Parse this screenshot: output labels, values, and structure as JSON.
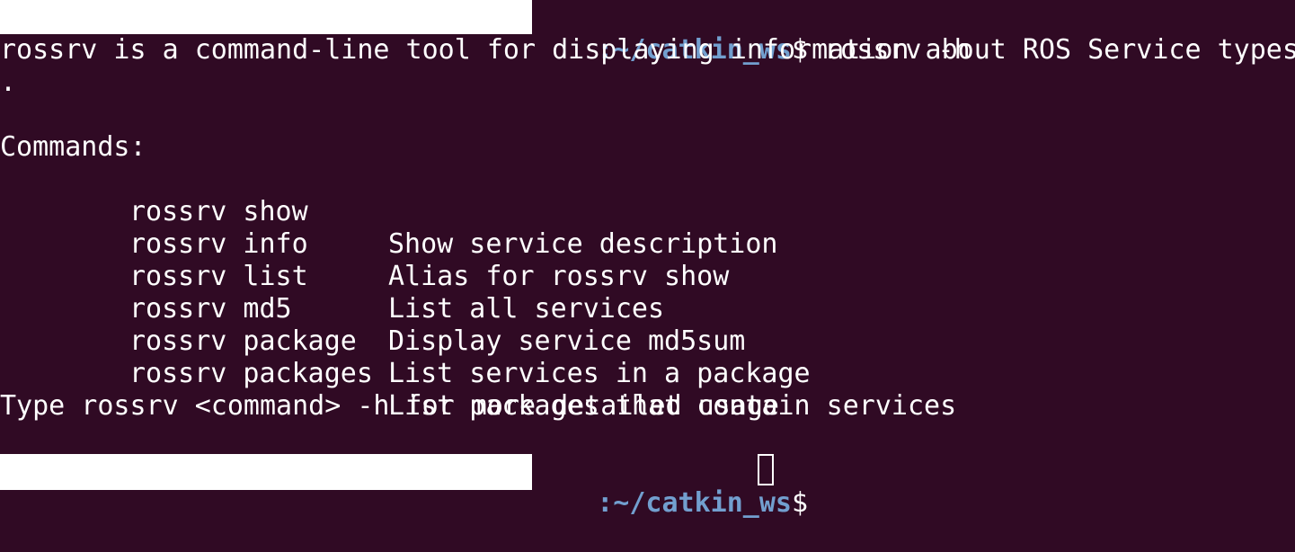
{
  "prompt1": {
    "path": ":~/catkin_ws",
    "symbol": "$",
    "command": " rossrv -h"
  },
  "output": {
    "description_line": "rossrv is a command-line tool for displaying information about ROS Service types",
    "description_wrap": ".",
    "commands_header": "Commands:",
    "commands": [
      {
        "name": "rossrv show",
        "desc": "Show service description"
      },
      {
        "name": "rossrv info",
        "desc": "Alias for rossrv show"
      },
      {
        "name": "rossrv list",
        "desc": "List all services"
      },
      {
        "name": "rossrv md5",
        "desc": "Display service md5sum"
      },
      {
        "name": "rossrv package",
        "desc": "List services in a package"
      },
      {
        "name": "rossrv packages",
        "desc": "List packages that contain services"
      }
    ],
    "footer": "Type rossrv <command> -h for more detailed usage"
  },
  "prompt2": {
    "path": ":~/catkin_ws",
    "symbol": "$"
  },
  "colors": {
    "background": "#300a24",
    "text": "#ffffff",
    "path": "#729fcf"
  }
}
